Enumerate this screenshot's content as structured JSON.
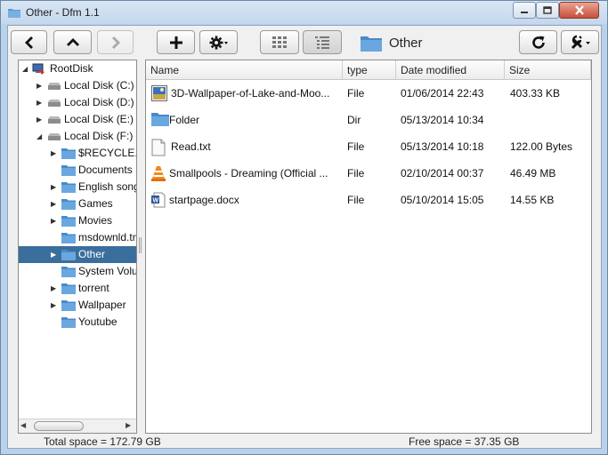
{
  "window": {
    "title": "Other - Dfm 1.1"
  },
  "toolbar": {
    "back": "back-icon",
    "up": "up-icon",
    "forward": "forward-icon",
    "new": "plus-icon",
    "settings": "gear-icon",
    "view_grid": "grid-view-icon",
    "view_list": "list-view-icon",
    "refresh": "refresh-icon",
    "tools": "tools-icon",
    "current_folder": "Other"
  },
  "tree": {
    "root": "RootDisk",
    "items": [
      {
        "label": "Local Disk (C:)",
        "type": "drive",
        "expander": "collapsed"
      },
      {
        "label": "Local Disk (D:)",
        "type": "drive",
        "expander": "collapsed"
      },
      {
        "label": "Local Disk (E:)",
        "type": "drive",
        "expander": "collapsed"
      },
      {
        "label": "Local Disk (F:)",
        "type": "drive",
        "expander": "expanded"
      },
      {
        "label": "$RECYCLE.BIN",
        "type": "folder",
        "expander": "collapsed"
      },
      {
        "label": "Documents",
        "type": "folder",
        "expander": "none"
      },
      {
        "label": "English songs",
        "type": "folder",
        "expander": "collapsed"
      },
      {
        "label": "Games",
        "type": "folder",
        "expander": "collapsed"
      },
      {
        "label": "Movies",
        "type": "folder",
        "expander": "collapsed"
      },
      {
        "label": "msdownld.tmp",
        "type": "folder",
        "expander": "none"
      },
      {
        "label": "Other",
        "type": "folder",
        "expander": "collapsed",
        "selected": true
      },
      {
        "label": "System Volume Information",
        "type": "folder",
        "expander": "none"
      },
      {
        "label": "torrent",
        "type": "folder",
        "expander": "collapsed"
      },
      {
        "label": "Wallpaper",
        "type": "folder",
        "expander": "collapsed"
      },
      {
        "label": "Youtube",
        "type": "folder",
        "expander": "none"
      }
    ]
  },
  "files": {
    "columns": [
      "Name",
      "type",
      "Date modified",
      "Size"
    ],
    "rows": [
      {
        "name": "3D-Wallpaper-of-Lake-and-Moo...",
        "type": "File",
        "date": "01/06/2014 22:43",
        "size": "403.33 KB",
        "icon": "image-icon"
      },
      {
        "name": "Folder",
        "type": "Dir",
        "date": "05/13/2014 10:34",
        "size": "",
        "icon": "folder-icon"
      },
      {
        "name": "Read.txt",
        "type": "File",
        "date": "05/13/2014 10:18",
        "size": "122.00 Bytes",
        "icon": "text-file-icon"
      },
      {
        "name": "Smallpools - Dreaming (Official ...",
        "type": "File",
        "date": "02/10/2014 00:37",
        "size": "46.49 MB",
        "icon": "vlc-icon"
      },
      {
        "name": "startpage.docx",
        "type": "File",
        "date": "05/10/2014 15:05",
        "size": "14.55 KB",
        "icon": "word-doc-icon"
      }
    ]
  },
  "status": {
    "total_space": "Total space =  172.79 GB",
    "free_space": "Free space =  37.35 GB"
  },
  "colors": {
    "selection": "#3a6e9c",
    "folder": "#5b9bd5",
    "titlebar": "#c4d7ec"
  }
}
